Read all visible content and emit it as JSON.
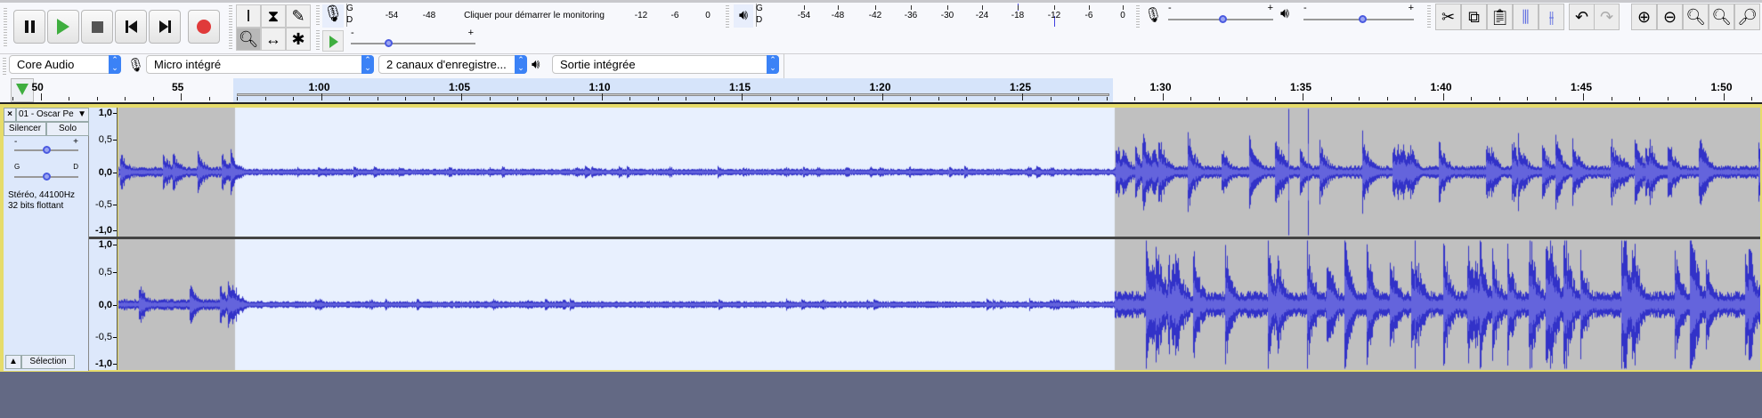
{
  "transport": {
    "buttons": [
      {
        "name": "pause",
        "icon": "pause-icon"
      },
      {
        "name": "play",
        "icon": "play-icon"
      },
      {
        "name": "stop",
        "icon": "stop-icon"
      },
      {
        "name": "skip-start",
        "icon": "skip-start-icon"
      },
      {
        "name": "skip-end",
        "icon": "skip-end-icon"
      },
      {
        "name": "record",
        "icon": "record-icon"
      }
    ]
  },
  "tools": [
    "selection-tool",
    "envelope-tool",
    "draw-tool",
    "zoom-tool",
    "time-shift-tool",
    "multi-tool"
  ],
  "record_meter": {
    "channel_left": "G",
    "channel_right": "D",
    "scale": [
      "-54",
      "-48",
      "-12",
      "-6",
      "0"
    ],
    "monitor_hint": "Cliquer pour démarrer le monitoring"
  },
  "play_meter": {
    "channel_left": "G",
    "channel_right": "D",
    "scale": [
      "-54",
      "-48",
      "-42",
      "-36",
      "-30",
      "-24",
      "-18",
      "-12",
      "-6",
      "0"
    ]
  },
  "play_at_speed": {
    "minus": "-",
    "plus": "+",
    "value": 0.3
  },
  "mixer": {
    "rec_minus": "-",
    "rec_plus": "+",
    "rec_volume": 0.55,
    "play_minus": "-",
    "play_plus": "+",
    "play_volume": 0.57
  },
  "devices": {
    "host": "Core Audio",
    "input": "Micro intégré",
    "channels": "2 canaux d'enregistre...",
    "output": "Sortie intégrée"
  },
  "ruler": {
    "labels": [
      "50",
      "55",
      "1:00",
      "1:05",
      "1:10",
      "1:15",
      "1:20",
      "1:25",
      "1:30",
      "1:35",
      "1:40",
      "1:45",
      "1:50"
    ]
  },
  "track": {
    "name": "01 - Oscar Pe",
    "mute": "Silencer",
    "solo": "Solo",
    "gain_minus": "-",
    "gain_plus": "+",
    "pan_left": "G",
    "pan_right": "D",
    "info_line1": "Stéréo, 44100Hz",
    "info_line2": "32 bits flottant",
    "select_button": "Sélection",
    "scale": [
      "1,0",
      "0,5",
      "0,0",
      "-0,5",
      "-1,0"
    ]
  },
  "colors": {
    "waveform": "#3232c8",
    "rms": "#6464dc",
    "unselected_bg": "#c0c0c0",
    "selected_bg": "#e8f0fe",
    "background": "#636984"
  }
}
